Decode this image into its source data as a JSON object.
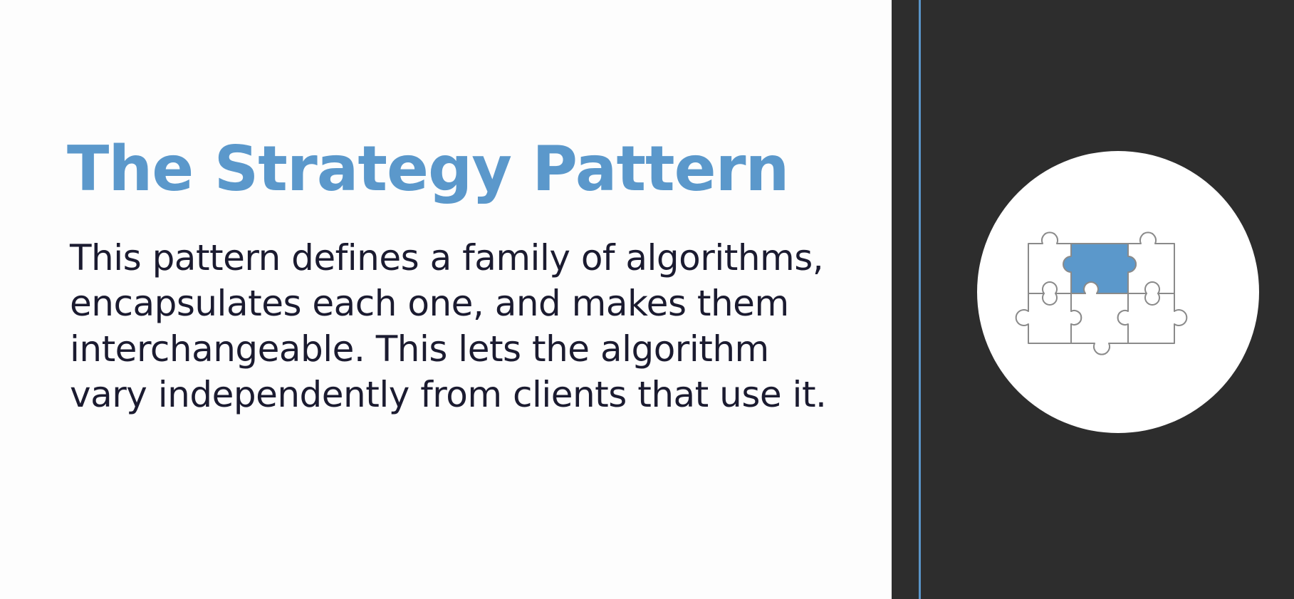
{
  "slide": {
    "title": "The Strategy Pattern",
    "body_lines": [
      "This pattern defines a family of algorithms,",
      "encapsulates each one, and makes them",
      "interchangeable. This lets the algorithm",
      "vary independently from clients that use it."
    ]
  },
  "illustration": {
    "icon": "puzzle-pieces-icon"
  },
  "colors": {
    "title": "#5b98cb",
    "body_text": "#1b1b30",
    "text_background": "#fdfdfd",
    "dark_panel": "#2d2d2d",
    "accent_line": "#5a95c8",
    "piece_highlight": "#5b98cb",
    "piece_outline": "#8a8a8a",
    "badge": "#ffffff"
  }
}
